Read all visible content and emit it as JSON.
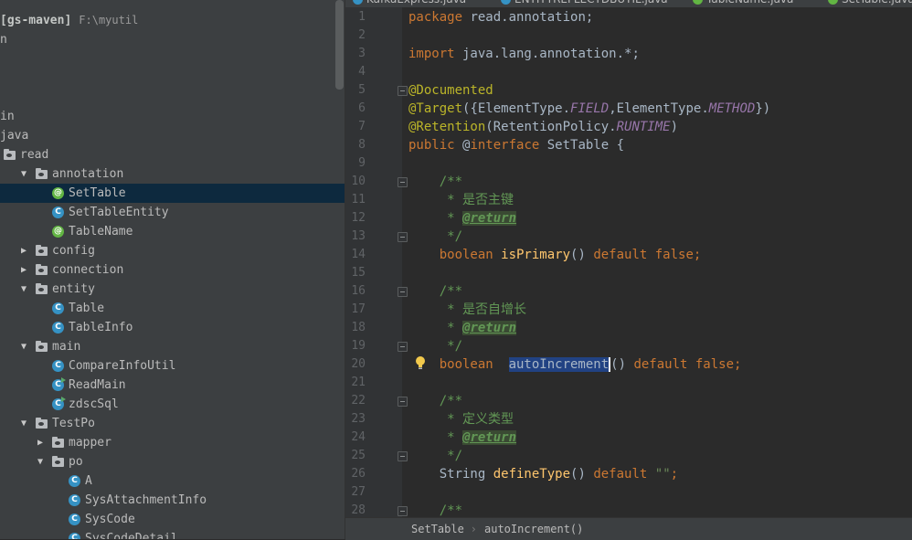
{
  "project": {
    "name": "[gs-maven]",
    "path": "F:\\myutil"
  },
  "tree": [
    {
      "label": "n",
      "indent": 0,
      "arrow": "",
      "icon": "none"
    },
    {
      "label": "in",
      "indent": 0,
      "arrow": "",
      "icon": "none"
    },
    {
      "label": "java",
      "indent": 0,
      "arrow": "",
      "icon": "none"
    },
    {
      "label": "read",
      "indent": 0,
      "arrow": "",
      "icon": "folder"
    },
    {
      "label": "annotation",
      "indent": 1,
      "arrow": "down",
      "icon": "folder"
    },
    {
      "label": "SetTable",
      "indent": 2,
      "arrow": "",
      "icon": "annotation",
      "selected": true
    },
    {
      "label": "SetTableEntity",
      "indent": 2,
      "arrow": "",
      "icon": "class"
    },
    {
      "label": "TableName",
      "indent": 2,
      "arrow": "",
      "icon": "annotation"
    },
    {
      "label": "config",
      "indent": 1,
      "arrow": "right",
      "icon": "folder"
    },
    {
      "label": "connection",
      "indent": 1,
      "arrow": "right",
      "icon": "folder"
    },
    {
      "label": "entity",
      "indent": 1,
      "arrow": "down",
      "icon": "folder"
    },
    {
      "label": "Table",
      "indent": 2,
      "arrow": "",
      "icon": "class"
    },
    {
      "label": "TableInfo",
      "indent": 2,
      "arrow": "",
      "icon": "class"
    },
    {
      "label": "main",
      "indent": 1,
      "arrow": "down",
      "icon": "folder"
    },
    {
      "label": "CompareInfoUtil",
      "indent": 2,
      "arrow": "",
      "icon": "class"
    },
    {
      "label": "ReadMain",
      "indent": 2,
      "arrow": "",
      "icon": "class-run"
    },
    {
      "label": "zdscSql",
      "indent": 2,
      "arrow": "",
      "icon": "class-run"
    },
    {
      "label": "TestPo",
      "indent": 1,
      "arrow": "down",
      "icon": "folder"
    },
    {
      "label": "mapper",
      "indent": 2,
      "arrow": "right",
      "icon": "folder"
    },
    {
      "label": "po",
      "indent": 2,
      "arrow": "down",
      "icon": "folder"
    },
    {
      "label": "A",
      "indent": 3,
      "arrow": "",
      "icon": "class"
    },
    {
      "label": "SysAttachmentInfo",
      "indent": 3,
      "arrow": "",
      "icon": "class"
    },
    {
      "label": "SysCode",
      "indent": 3,
      "arrow": "",
      "icon": "class"
    },
    {
      "label": "SysCodeDetail",
      "indent": 3,
      "arrow": "",
      "icon": "class"
    }
  ],
  "tabs": [
    {
      "label": "KafkaExpress.java",
      "icon": "class"
    },
    {
      "label": "ENTITYREFLECTDBUTIL.java",
      "icon": "class"
    },
    {
      "label": "TableName.java",
      "icon": "annotation"
    },
    {
      "label": "SetTable.java",
      "icon": "annotation",
      "active": true
    }
  ],
  "line_numbers": [
    "1",
    "2",
    "3",
    "4",
    "5",
    "6",
    "7",
    "8",
    "9",
    "10",
    "11",
    "12",
    "13",
    "14",
    "15",
    "16",
    "17",
    "18",
    "19",
    "20",
    "21",
    "22",
    "23",
    "24",
    "25",
    "26",
    "27",
    "28"
  ],
  "code": {
    "l1_kw": "package",
    "l1_rest": " read.annotation;",
    "l3_kw": "import",
    "l3_rest": " java.lang.annotation.*;",
    "l5": "@Documented",
    "l6_ann": "@Target",
    "l6_a": "({ElementType.",
    "l6_f1": "FIELD",
    "l6_b": ",ElementType.",
    "l6_f2": "METHOD",
    "l6_c": "})",
    "l7_ann": "@Retention",
    "l7_a": "(RetentionPolicy.",
    "l7_f": "RUNTIME",
    "l7_b": ")",
    "l8_kw": "public",
    "l8_a": " @",
    "l8_kw2": "interface",
    "l8_b": " SetTable {",
    "doc_open": "    /**",
    "doc_close": "     */",
    "doc_star": "     * ",
    "return_tag": "@return",
    "l11_text": "是否主键",
    "l14_kw": "    boolean",
    "l14_m": " isPrimary",
    "l14_a": "() ",
    "l14_kw2": "default false",
    "l14_b": ";",
    "l17_text": "是否自增长",
    "l20_kw": "    boolean  ",
    "l20_m": "autoIncrement",
    "l20_a": "() ",
    "l20_kw2": "default false",
    "l20_b": ";",
    "l23_text": "定义类型",
    "l26_a": "    String ",
    "l26_m": "defineType",
    "l26_b": "() ",
    "l26_kw": "default",
    "l26_c": " ",
    "l26_s": "\"\"",
    "l26_d": ";"
  },
  "breadcrumbs": [
    "SetTable",
    "autoIncrement()"
  ],
  "colors": {
    "selection": "#0d293e",
    "keyword": "#cc7832",
    "annotation": "#bbb529",
    "doc": "#629755",
    "method": "#ffc66d"
  }
}
